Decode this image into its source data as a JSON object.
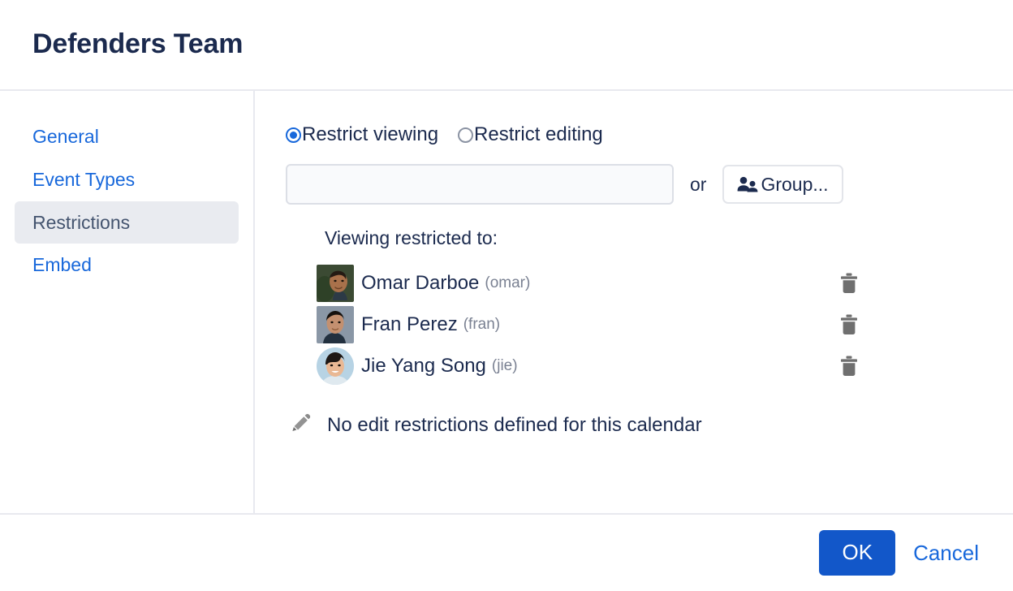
{
  "dialog": {
    "title": "Defenders Team"
  },
  "sidebar": {
    "items": [
      {
        "label": "General",
        "active": false
      },
      {
        "label": "Event Types",
        "active": false
      },
      {
        "label": "Restrictions",
        "active": true
      },
      {
        "label": "Embed",
        "active": false
      }
    ]
  },
  "restrictions": {
    "radios": [
      {
        "label": "Restrict viewing",
        "selected": true
      },
      {
        "label": "Restrict editing",
        "selected": false
      }
    ],
    "name_input": {
      "value": "",
      "placeholder": ""
    },
    "or_label": "or",
    "group_button": {
      "label": "Group...",
      "icon": "users-icon"
    },
    "list_heading": "Viewing restricted to:",
    "users": [
      {
        "name": "Omar Darboe",
        "handle": "(omar)",
        "avatar_shape": "square",
        "avatar_bg": "#3b4a33",
        "skin": "#a9714b",
        "hair": "#241a13",
        "delete_icon": "trash-icon"
      },
      {
        "name": "Fran Perez",
        "handle": "(fran)",
        "avatar_shape": "square",
        "avatar_bg": "#8a97a6",
        "skin": "#c39070",
        "hair": "#15110e",
        "delete_icon": "trash-icon"
      },
      {
        "name": "Jie Yang Song",
        "handle": "(jie)",
        "avatar_shape": "circle",
        "avatar_bg": "#b7d3e4",
        "skin": "#e9b894",
        "hair": "#1d1714",
        "delete_icon": "trash-icon"
      }
    ],
    "no_edit_restrictions": {
      "icon": "pencil-icon",
      "text": "No edit restrictions defined for this calendar"
    }
  },
  "footer": {
    "ok_label": "OK",
    "cancel_label": "Cancel"
  },
  "colors": {
    "accent_blue": "#1868db",
    "primary_button": "#1257c9",
    "text_dark": "#1b2a4e",
    "muted_text": "#7a8192",
    "divider": "#e8e9ef",
    "active_nav_bg": "#e9ebf0"
  }
}
